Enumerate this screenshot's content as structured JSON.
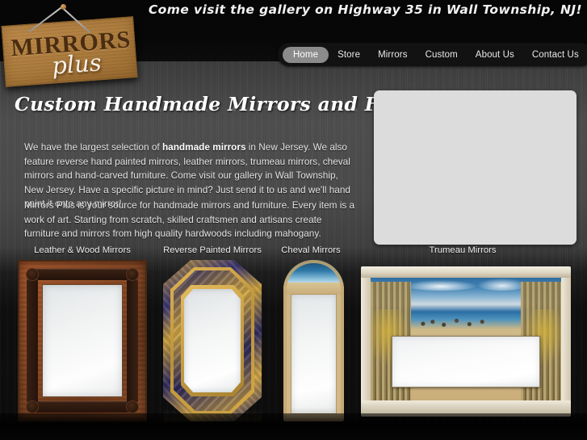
{
  "site": {
    "logo_main": "MIRRORS",
    "logo_sub": "plus",
    "tagline": "Come visit the gallery on Highway 35 in Wall Township, NJ!"
  },
  "nav": {
    "items": [
      {
        "label": "Home",
        "active": true
      },
      {
        "label": "Store",
        "active": false
      },
      {
        "label": "Mirrors",
        "active": false
      },
      {
        "label": "Custom",
        "active": false
      },
      {
        "label": "About Us",
        "active": false
      },
      {
        "label": "Contact Us",
        "active": false
      }
    ]
  },
  "main": {
    "headline": "Custom Handmade Mirrors and Furniture",
    "paragraph1_part1": "We have the largest selection of ",
    "paragraph1_bold": "handmade mirrors",
    "paragraph1_part2": " in New Jersey. We also feature reverse hand painted mirrors, leather mirrors, trumeau mirrors, cheval mirrors and hand-carved furniture. Come visit our gallery in Wall Township, New Jersey. Have a specific picture in mind? Just send it to us and we'll hand paint it onto any mirror!",
    "paragraph2": "Mirrors Plus is your source for handmade mirrors and furniture. Every item is a work of art. Starting from scratch, skilled craftsmen and artisans create furniture and mirrors from high quality hardwoods including mahogany."
  },
  "gallery": {
    "captions": [
      "Leather & Wood Mirrors",
      "Reverse Painted Mirrors",
      "Cheval Mirrors",
      "Trumeau Mirrors"
    ]
  },
  "colors": {
    "sign_wood": "#b07f3f",
    "sign_text": "#4a2c10",
    "nav_bar": "#121212",
    "nav_active": "#8b8b8b",
    "background_dark": "#0a0a0a",
    "background_mid": "#4a4a4a",
    "body_text": "#e3e3e3",
    "slideshow_placeholder": "#dcdcdc"
  }
}
